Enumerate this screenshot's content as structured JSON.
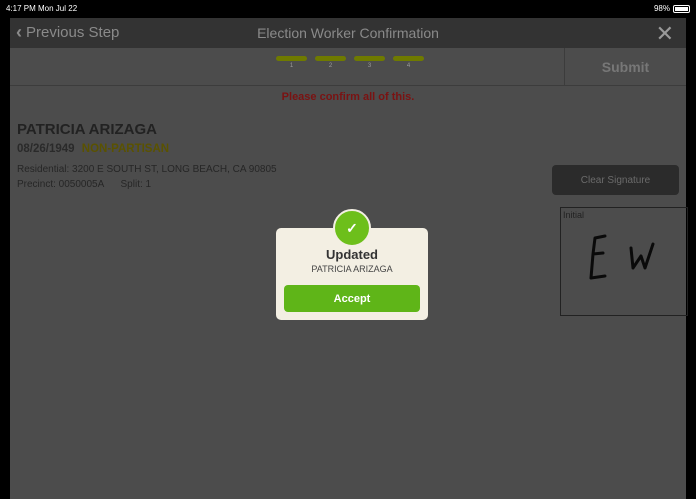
{
  "statusbar": {
    "time": "4:17 PM  Mon Jul 22",
    "battery": "98%"
  },
  "nav": {
    "back_label": "Previous Step",
    "title": "Election Worker Confirmation",
    "close_icon": "close-icon"
  },
  "steps": [
    {
      "num": "1"
    },
    {
      "num": "2"
    },
    {
      "num": "3"
    },
    {
      "num": "4"
    }
  ],
  "submit_label": "Submit",
  "confirm_message": "Please confirm all of this.",
  "voter": {
    "name": "PATRICIA ARIZAGA",
    "dob": "08/26/1949",
    "party": "NON-PARTISAN",
    "residential": "Residential: 3200 E SOUTH ST, LONG BEACH, CA 90805",
    "precinct": "Precinct: 0050005A",
    "split": "Split: 1"
  },
  "signature": {
    "clear_label": "Clear Signature",
    "box_label": "Initial"
  },
  "dialog": {
    "title": "Updated",
    "subtitle": "PATRICIA ARIZAGA",
    "accept_label": "Accept",
    "icon": "check-icon"
  },
  "colors": {
    "accent_green": "#5fb518",
    "step_olive": "#6f7a00",
    "warning_red": "#7a1212"
  }
}
